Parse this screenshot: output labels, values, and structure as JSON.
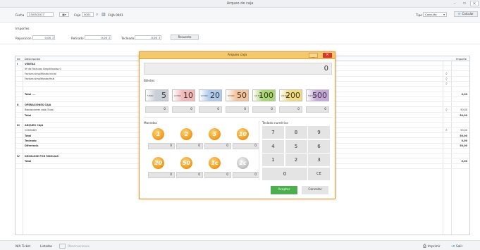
{
  "window": {
    "title": "Arqueo de caja"
  },
  "toolbar": {
    "fecha_label": "Fecha",
    "fecha_value": "23/05/2017",
    "caja_label": "Caja",
    "caja_value": "0001",
    "caja_name": "CAJA 0001",
    "tipo_label": "Tipo",
    "tipo_value": "Consulta",
    "calcular_label": "Calcular"
  },
  "importes": {
    "heading": "Importes",
    "reposicion_label": "Reposicion",
    "reposicion_value": "0,00",
    "retirado_label": "Retirado",
    "retirado_value": "0,00",
    "tecleado_label": "Tecleado",
    "tecleado_value": "0,00",
    "recuento_label": "Recuento"
  },
  "grid": {
    "col_n": "de",
    "col_desc": "Descripción",
    "col_importe": "Importe",
    "rows": [
      {
        "n": "I",
        "d": "VENTAS",
        "v": "",
        "bold": true,
        "search": false
      },
      {
        "n": "",
        "d": "Nº de Facturas Simplificadas 0",
        "v": "",
        "bold": false,
        "search": false
      },
      {
        "n": "",
        "d": "Factura simplificada inicial",
        "v": "",
        "bold": false,
        "search": true
      },
      {
        "n": "",
        "d": "Factura simplificada final",
        "v": "",
        "bold": false,
        "search": true
      },
      {
        "n": "",
        "d": "",
        "v": "",
        "bold": false,
        "search": true
      },
      {
        "n": "",
        "d": "",
        "v": "",
        "bold": false,
        "search": false
      },
      {
        "n": "",
        "d": "Total ....",
        "v": "0,00",
        "bold": true,
        "search": false
      },
      {
        "n": "",
        "d": "",
        "v": "",
        "bold": false,
        "search": false
      },
      {
        "n": "II",
        "d": "OPERACIONES CAJA",
        "v": "",
        "bold": true,
        "search": false
      },
      {
        "n": "",
        "d": "Reposiciones caja (Euro)",
        "v": "50,00",
        "bold": false,
        "search": true
      },
      {
        "n": "",
        "d": "Total",
        "v": "50,00",
        "bold": true,
        "search": false
      },
      {
        "n": "",
        "d": "",
        "v": "",
        "bold": false,
        "search": false
      },
      {
        "n": "III",
        "d": "ARQUEO CAJA",
        "v": "",
        "bold": true,
        "search": false
      },
      {
        "n": "",
        "d": "CONTADO",
        "v": "50,00",
        "bold": false,
        "search": true
      },
      {
        "n": "",
        "d": "Total",
        "v": "50,00",
        "bold": true,
        "search": false
      },
      {
        "n": "",
        "d": "Tecleado",
        "v": "0,00",
        "bold": true,
        "search": false
      },
      {
        "n": "",
        "d": "Diferencia",
        "v": "50,00",
        "bold": true,
        "search": false
      },
      {
        "n": "",
        "d": "",
        "v": "",
        "bold": false,
        "search": false
      },
      {
        "n": "IV",
        "d": "DESGLOSE POR FAMILIAS",
        "v": "",
        "bold": true,
        "search": false
      },
      {
        "n": "",
        "d": "Total",
        "v": "0,00",
        "bold": true,
        "search": false
      },
      {
        "n": "",
        "d": "",
        "v": "",
        "bold": false,
        "search": false
      }
    ]
  },
  "bottom": {
    "ticket_label": "N/A Ticket",
    "listados_label": "Listados",
    "observaciones_label": "Observaciones",
    "imprimir_label": "Imprimir",
    "salir_label": "Salir"
  },
  "modal": {
    "title": "Arqueo caja",
    "display_value": "0",
    "billetes_label": "Billetes",
    "monedas_label": "Monedas",
    "teclado_label": "Teclado numérico",
    "bills": [
      {
        "value": "5",
        "mini": "5 EURO",
        "color": "#c9cfd6",
        "count": "0"
      },
      {
        "value": "10",
        "mini": "10 EURO",
        "color": "#f4b8b8",
        "count": "0"
      },
      {
        "value": "20",
        "mini": "20 EURO",
        "color": "#aecbee",
        "count": "0"
      },
      {
        "value": "50",
        "mini": "50 EURO",
        "color": "#f6c49a",
        "count": "0"
      },
      {
        "value": "100",
        "mini": "100 EURO",
        "color": "#a9d86e",
        "count": "0"
      },
      {
        "value": "200",
        "mini": "200 EURO",
        "color": "#f3dc7a",
        "count": "0"
      },
      {
        "value": "500",
        "mini": "500 EURO",
        "color": "#c7a8dd",
        "count": "0"
      }
    ],
    "coins": [
      {
        "label": "1",
        "color": "gold",
        "count": "0"
      },
      {
        "label": "2",
        "color": "gold",
        "count": "0"
      },
      {
        "label": "5",
        "color": "gold",
        "count": "0"
      },
      {
        "label": "10",
        "color": "gold",
        "count": "0"
      },
      {
        "label": "20",
        "color": "gold",
        "count": "0"
      },
      {
        "label": "50",
        "color": "gold",
        "count": "0"
      },
      {
        "label": "1c",
        "color": "gold",
        "count": "0"
      },
      {
        "label": "2c",
        "color": "silver",
        "count": "0"
      }
    ],
    "keys": [
      "7",
      "8",
      "9",
      "4",
      "5",
      "6",
      "1",
      "2",
      "3",
      "0",
      "CE"
    ],
    "aceptar_label": "Aceptar",
    "cancelar_label": "Cancelar"
  }
}
